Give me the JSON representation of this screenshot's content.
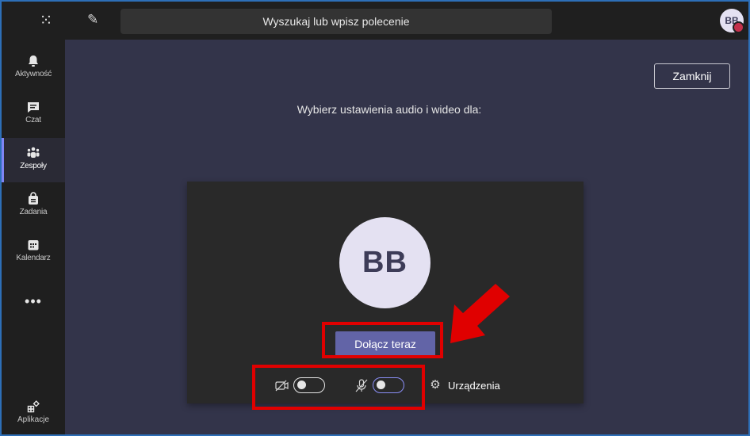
{
  "topbar": {
    "search_placeholder": "Wyszukaj lub wpisz polecenie",
    "avatar_initials": "BB"
  },
  "rail": {
    "items": [
      {
        "label": "Aktywność",
        "icon": "bell-icon"
      },
      {
        "label": "Czat",
        "icon": "chat-icon"
      },
      {
        "label": "Zespoły",
        "icon": "teams-icon",
        "active": true
      },
      {
        "label": "Zadania",
        "icon": "tasks-icon"
      },
      {
        "label": "Kalendarz",
        "icon": "calendar-icon"
      }
    ],
    "apps_label": "Aplikacje"
  },
  "main": {
    "close_label": "Zamknij",
    "prompt_text": "Wybierz ustawienia audio i wideo dla:",
    "preview_initials": "BB",
    "join_label": "Dołącz teraz",
    "devices_label": "Urządzenia",
    "video_on": false,
    "mic_on": false
  },
  "colors": {
    "accent": "#6264a7",
    "highlight": "#e00000",
    "presence_busy": "#c4314b"
  }
}
